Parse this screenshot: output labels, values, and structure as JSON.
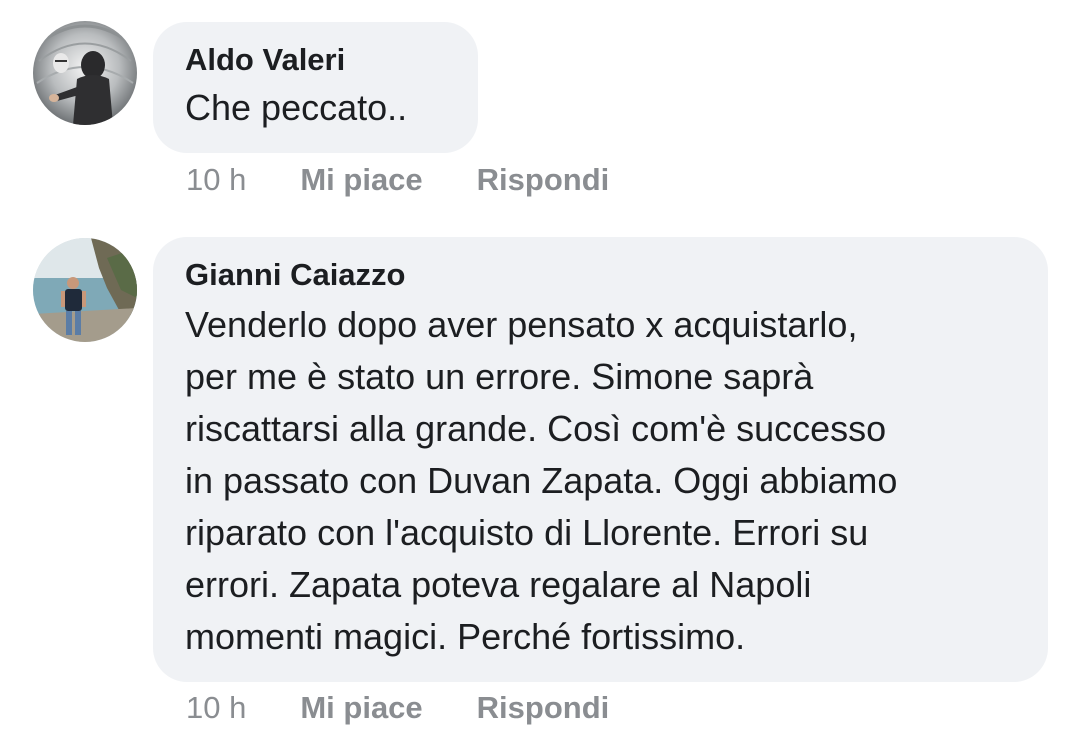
{
  "comments": [
    {
      "author": "Aldo Valeri",
      "lines": [
        "Che peccato.."
      ],
      "time": "10 h",
      "like_label": "Mi piace",
      "reply_label": "Rispondi"
    },
    {
      "author": "Gianni Caiazzo",
      "lines": [
        "Venderlo dopo aver pensato x acquistarlo,",
        "per me è stato un errore. Simone saprà",
        "riscattarsi alla grande. Così com'è successo",
        "in passato con Duvan Zapata. Oggi abbiamo",
        "riparato con l'acquisto di Llorente. Errori su",
        "errori. Zapata poteva regalare al Napoli",
        "momenti magici. Perché fortissimo."
      ],
      "time": "10 h",
      "like_label": "Mi piace",
      "reply_label": "Rispondi"
    }
  ],
  "colors": {
    "bubble": "#f0f2f5",
    "text": "#1c1e21",
    "meta": "#8a8d91"
  }
}
